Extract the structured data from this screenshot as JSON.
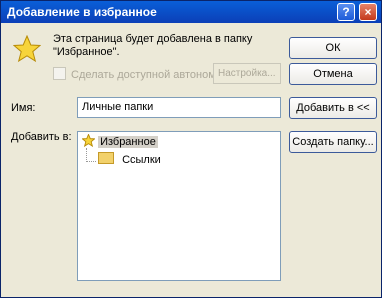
{
  "window": {
    "title": "Добавление в избранное",
    "help_label": "?",
    "close_label": "×"
  },
  "message": {
    "line1": "Эта страница будет добавлена в папку",
    "line2": "\"Избранное\"."
  },
  "offline": {
    "checkbox_label": "Сделать доступной автономно",
    "settings_button": "Настройка..."
  },
  "buttons": {
    "ok": "ОК",
    "cancel": "Отмена",
    "add_to": "Добавить в <<",
    "new_folder": "Создать папку..."
  },
  "name_field": {
    "label": "Имя:",
    "value": "Личные папки"
  },
  "add_to": {
    "label": "Добавить в:",
    "tree": [
      {
        "label": "Избранное",
        "icon": "star-icon",
        "selected": true
      },
      {
        "label": "Ссылки",
        "icon": "folder-icon",
        "selected": false
      }
    ]
  },
  "colors": {
    "title_bar": "#0b4fd0",
    "dialog_bg": "#ece9d8"
  }
}
